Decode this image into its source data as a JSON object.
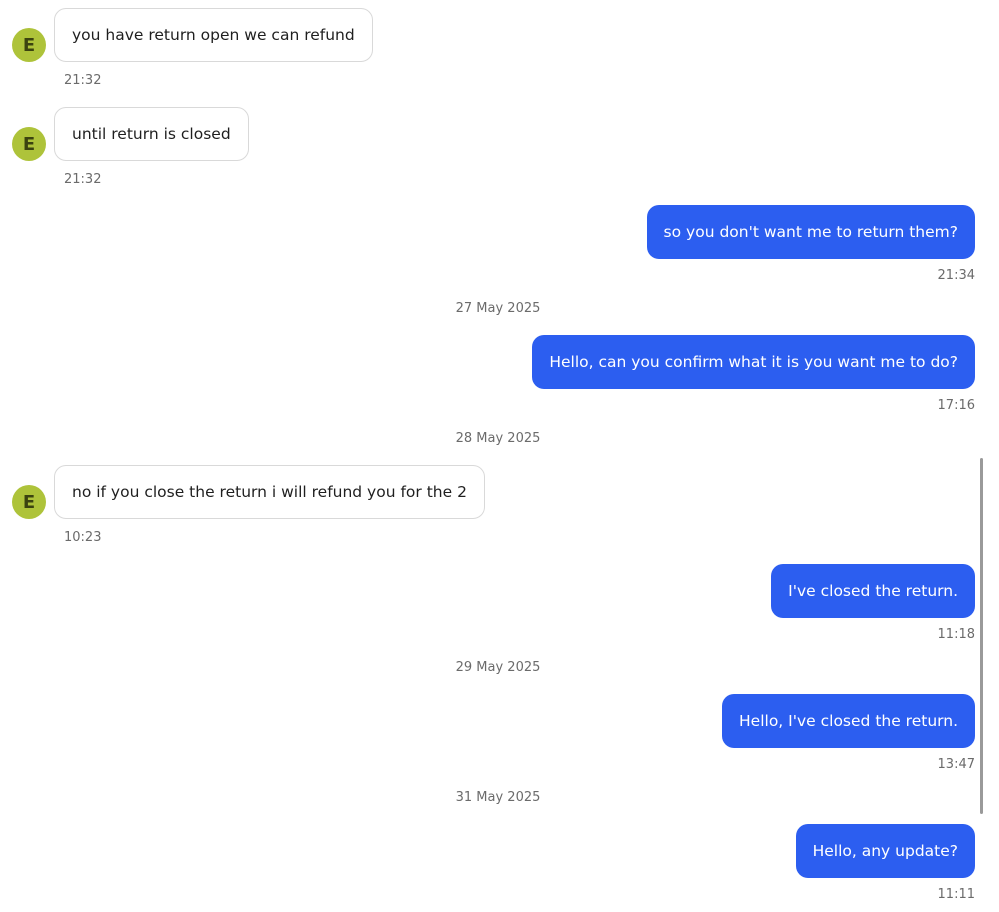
{
  "avatar_initial": "E",
  "colors": {
    "avatar_bg": "#aec33a",
    "outgoing_bubble": "#2c5ef0",
    "incoming_border": "#d9d9d9"
  },
  "messages": [
    {
      "direction": "in",
      "text": "you have return open we can refund",
      "time": "21:32"
    },
    {
      "direction": "in",
      "text": "until return is closed",
      "time": "21:32"
    },
    {
      "direction": "out",
      "text": "so you don't want me to return them?",
      "time": "21:34"
    },
    {
      "date_separator": "27 May 2025"
    },
    {
      "direction": "out",
      "text": "Hello, can you confirm what it is you want me to do?",
      "time": "17:16"
    },
    {
      "date_separator": "28 May 2025"
    },
    {
      "direction": "in",
      "text": "no if you close the return i will refund you for the 2",
      "time": "10:23"
    },
    {
      "direction": "out",
      "text": "I've closed the return.",
      "time": "11:18"
    },
    {
      "date_separator": "29 May 2025"
    },
    {
      "direction": "out",
      "text": "Hello, I've closed the return.",
      "time": "13:47"
    },
    {
      "date_separator": "31 May 2025"
    },
    {
      "direction": "out",
      "text": "Hello, any update?",
      "time": "11:11"
    }
  ]
}
